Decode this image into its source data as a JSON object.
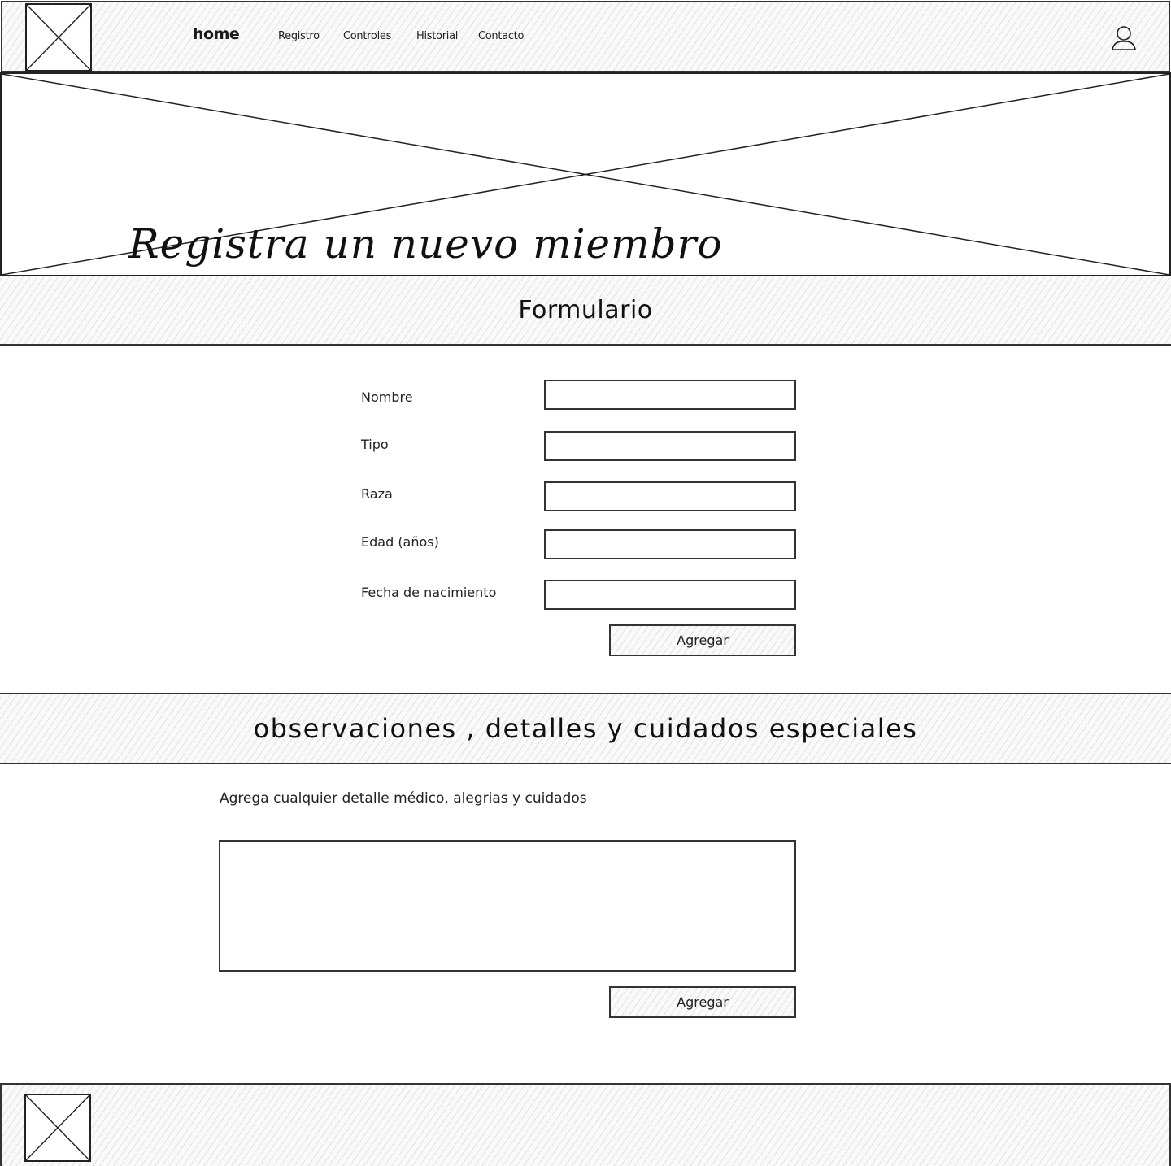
{
  "header": {
    "brand": "home",
    "nav": [
      "Registro",
      "Controles",
      "Historial",
      "Contacto"
    ]
  },
  "hero": {
    "title": "Registra un nuevo miembro"
  },
  "form_section": {
    "title": "Formulario",
    "fields": [
      {
        "label": "Nombre",
        "value": ""
      },
      {
        "label": "Tipo",
        "value": ""
      },
      {
        "label": "Raza",
        "value": ""
      },
      {
        "label": "Edad (años)",
        "value": ""
      },
      {
        "label": "Fecha de nacimiento",
        "value": ""
      }
    ],
    "submit_label": "Agregar"
  },
  "observations_section": {
    "title": "observaciones , detalles y cuidados especiales",
    "help_text": "Agrega cualquier detalle médico, alegrias y cuidados",
    "textarea_value": "",
    "submit_label": "Agregar"
  },
  "icons": {
    "user": "user-icon",
    "image_placeholder": "image-placeholder-icon"
  }
}
